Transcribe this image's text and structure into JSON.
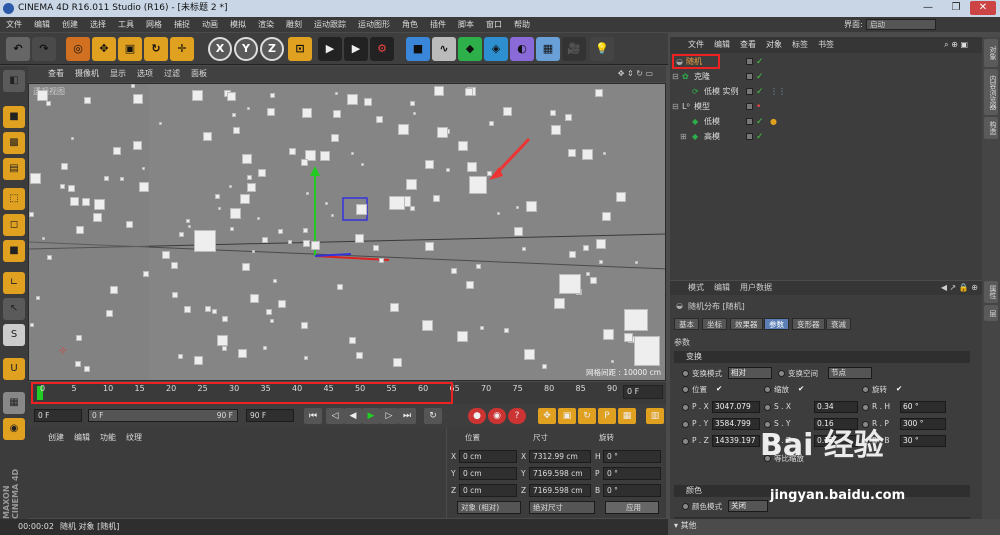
{
  "window": {
    "title": "CINEMA 4D R16.011 Studio (R16) - [未标题 2 *]",
    "min": "—",
    "max": "❐",
    "close": "✕"
  },
  "menubar": {
    "items": [
      "文件",
      "编辑",
      "创建",
      "选择",
      "工具",
      "网格",
      "捕捉",
      "动画",
      "模拟",
      "渲染",
      "雕刻",
      "运动跟踪",
      "运动图形",
      "角色",
      "插件",
      "脚本",
      "窗口",
      "帮助"
    ],
    "interface_label": "界面:",
    "interface_value": "启动"
  },
  "toolbar": {
    "x": "X",
    "y": "Y",
    "z": "Z"
  },
  "viewport": {
    "menu": [
      "查看",
      "摄像机",
      "显示",
      "选项",
      "过滤",
      "面板"
    ],
    "label": "透视视图",
    "grid": "网格间距 : 10000 cm"
  },
  "timeline": {
    "ticks": [
      "0",
      "5",
      "10",
      "15",
      "20",
      "25",
      "30",
      "35",
      "40",
      "45",
      "50",
      "55",
      "60",
      "65",
      "70",
      "75",
      "80",
      "85",
      "90"
    ],
    "frame": "0 F"
  },
  "transport": {
    "start": "0 F",
    "cur": "0 F",
    "end_a": "90 F",
    "end_b": "90 F"
  },
  "material": {
    "menu": [
      "创建",
      "编辑",
      "功能",
      "纹理"
    ]
  },
  "coords": {
    "headers": [
      "位置",
      "尺寸",
      "旋转"
    ],
    "rows": [
      {
        "a": "X",
        "pos": "0 cm",
        "b": "X",
        "size": "7312.99 cm",
        "c": "H",
        "rot": "0 °"
      },
      {
        "a": "Y",
        "pos": "0 cm",
        "b": "Y",
        "size": "7169.598 cm",
        "c": "P",
        "rot": "0 °"
      },
      {
        "a": "Z",
        "pos": "0 cm",
        "b": "Z",
        "size": "7169.598 cm",
        "c": "B",
        "rot": "0 °"
      }
    ],
    "mode": "对象 (相对)",
    "sizemode": "绝对尺寸",
    "apply": "应用"
  },
  "status": {
    "time": "00:00:02",
    "text": "随机 对象 [随机]"
  },
  "objects": {
    "menu": [
      "文件",
      "编辑",
      "查看",
      "对象",
      "标签",
      "书签"
    ],
    "rows": [
      {
        "name": "随机"
      },
      {
        "name": "克隆"
      },
      {
        "name": "低模 实例"
      },
      {
        "name": "模型"
      },
      {
        "name": "低模"
      },
      {
        "name": "高模"
      }
    ]
  },
  "attributes": {
    "menu": [
      "模式",
      "编辑",
      "用户数据"
    ],
    "title": "随机分布 [随机]",
    "tabs": [
      "基本",
      "坐标",
      "效果器",
      "参数",
      "变形器",
      "衰减"
    ],
    "params_label": "参数",
    "transform_label": "变换",
    "transform_mode_label": "变换模式",
    "transform_mode": "相对",
    "transform_space_label": "变换空间",
    "transform_space": "节点",
    "pos_label": "位置",
    "scale_label": "缩放",
    "rot_label": "旋转",
    "px_label": "P . X",
    "px": "3047.079",
    "py_label": "P . Y",
    "py": "3584.799",
    "pz_label": "P . Z",
    "pz": "14339.197",
    "sx_label": "S . X",
    "sx": "0.34",
    "sy_label": "S . Y",
    "sy": "0.16",
    "sz_label": "S . Z",
    "sz": "0.17",
    "rh_label": "R . H",
    "rh": "60 °",
    "rp_label": "R . P",
    "rp": "300 °",
    "rb_label": "R . B",
    "rb": "30 °",
    "uniform_label": "等比缩放",
    "color_label": "颜色",
    "color_mode_label": "颜色模式",
    "color_mode": "关闭",
    "other_label": "其他"
  },
  "right_tabs": [
    "对象",
    "内容浏览器",
    "构造",
    "属性",
    "层"
  ],
  "watermark": {
    "text": "Bai 经验",
    "url": "jingyan.baidu.com"
  }
}
